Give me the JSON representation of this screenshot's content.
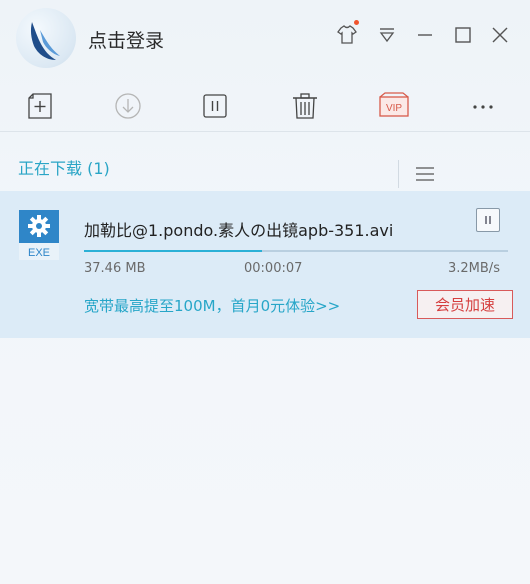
{
  "header": {
    "login_label": "点击登录"
  },
  "toolbar": {
    "items": [
      {
        "name": "new-task",
        "icon": "add-icon"
      },
      {
        "name": "start",
        "icon": "download-icon"
      },
      {
        "name": "pause",
        "icon": "pause-icon"
      },
      {
        "name": "delete",
        "icon": "trash-icon"
      },
      {
        "name": "vip",
        "icon": "vip-icon",
        "label": "VIP"
      },
      {
        "name": "more",
        "icon": "more-icon"
      }
    ]
  },
  "section": {
    "title": "正在下载 (1)"
  },
  "task": {
    "file_icon_label": "EXE",
    "file_name": "加勒比@1.pondo.素人の出镜apb-351.avi",
    "size": "37.46 MB",
    "elapsed": "00:00:07",
    "speed": "3.2MB/s",
    "progress": 0.42,
    "promo": "宽带最高提至100M，首月0元体验>>",
    "vip_speed_label": "会员加速"
  },
  "colors": {
    "accent": "#2aa5c6",
    "progress": "#2bb0d6",
    "vip_red": "#d53f3f",
    "row_bg": "#dcebf7"
  }
}
